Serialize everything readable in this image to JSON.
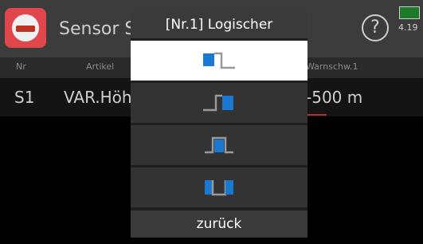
{
  "background": {
    "title": "Sensor S",
    "voltage": "4.19",
    "columns": {
      "nr": "Nr",
      "artikel": "Artikel",
      "warnschw": "Warnschw.1"
    },
    "row": {
      "nr": "S1",
      "artikel": "VAR.Höh",
      "warnschw": "-500 m"
    }
  },
  "dialog": {
    "title": "[Nr.1] Logischer",
    "options": [
      {
        "icon": "logic-below-threshold-icon",
        "selected": true
      },
      {
        "icon": "logic-above-threshold-icon",
        "selected": false
      },
      {
        "icon": "logic-in-window-icon",
        "selected": false
      },
      {
        "icon": "logic-outside-window-icon",
        "selected": false
      }
    ],
    "back_label": "zurück"
  },
  "colors": {
    "accent_blue": "#1a78d0",
    "selected_bg": "#ffffff",
    "option_bg": "#333333",
    "line_gray": "#9a9a9a"
  }
}
